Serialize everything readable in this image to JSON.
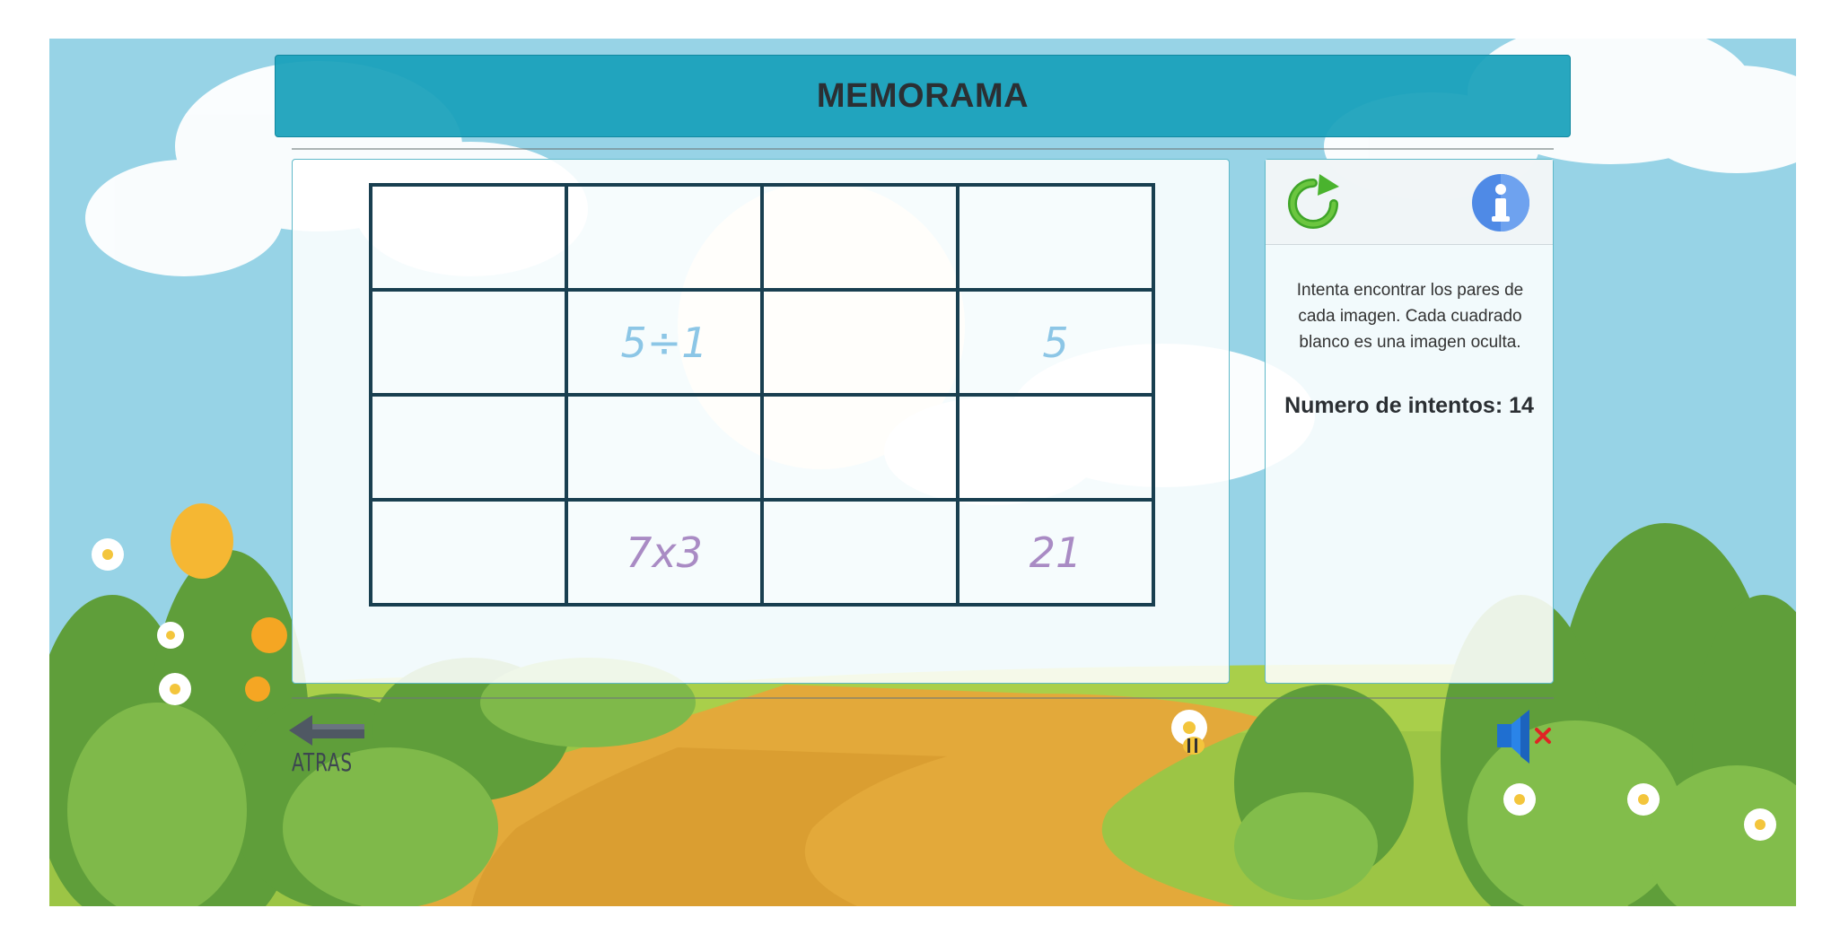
{
  "header": {
    "title": "MEMORAMA"
  },
  "board": {
    "cards": [
      {
        "text": "",
        "color": ""
      },
      {
        "text": "",
        "color": ""
      },
      {
        "text": "",
        "color": ""
      },
      {
        "text": "",
        "color": ""
      },
      {
        "text": "",
        "color": ""
      },
      {
        "text": "5÷1",
        "color": "#8cc6e6"
      },
      {
        "text": "",
        "color": ""
      },
      {
        "text": "5",
        "color": "#8cc6e6"
      },
      {
        "text": "",
        "color": ""
      },
      {
        "text": "",
        "color": ""
      },
      {
        "text": "",
        "color": ""
      },
      {
        "text": "",
        "color": ""
      },
      {
        "text": "",
        "color": ""
      },
      {
        "text": "7x3",
        "color": "#a98bc4"
      },
      {
        "text": "",
        "color": ""
      },
      {
        "text": "21",
        "color": "#a98bc4"
      }
    ]
  },
  "info": {
    "instructions": "Intenta encontrar los pares de cada imagen. Cada cuadrado blanco es una imagen oculta.",
    "attempts_label": "Numero de intentos: ",
    "attempts_value": "14"
  },
  "controls": {
    "refresh_icon": "refresh-icon",
    "info_icon": "info-icon",
    "back_label": "ATRAS",
    "sound_icon": "sound-muted-icon"
  },
  "colors": {
    "title_bar": "#18a0ba",
    "grid_lines": "#193f50"
  }
}
